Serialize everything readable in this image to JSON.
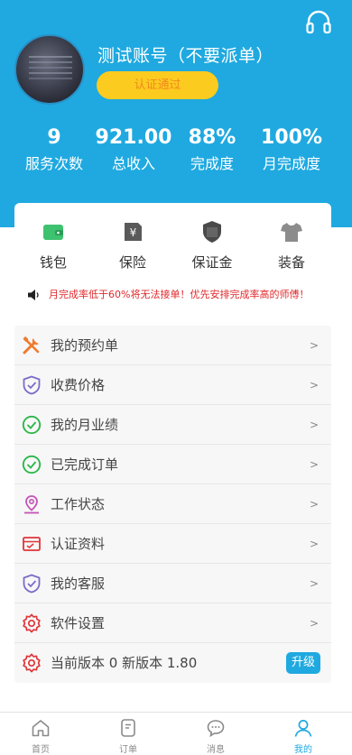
{
  "header": {
    "username": "测试账号（不要派单）",
    "verify_label": "认证通过"
  },
  "stats": [
    {
      "value": "9",
      "label": "服务次数"
    },
    {
      "value": "921.00",
      "label": "总收入"
    },
    {
      "value": "88%",
      "label": "完成度"
    },
    {
      "value": "100%",
      "label": "月完成度"
    }
  ],
  "quick_actions": [
    {
      "label": "钱包",
      "icon": "wallet-icon"
    },
    {
      "label": "保险",
      "icon": "insurance-icon"
    },
    {
      "label": "保证金",
      "icon": "deposit-icon"
    },
    {
      "label": "装备",
      "icon": "tshirt-icon"
    }
  ],
  "notice": {
    "text": "月完成率低于60%将无法接单！优先安排完成率高的师傅！"
  },
  "menu": [
    {
      "label": "我的预约单",
      "icon": "tools-icon",
      "chevron": ">"
    },
    {
      "label": "收费价格",
      "icon": "shield-check-icon",
      "chevron": ">"
    },
    {
      "label": "我的月业绩",
      "icon": "check-circle-icon",
      "chevron": ">"
    },
    {
      "label": "已完成订单",
      "icon": "check-circle-icon",
      "chevron": ">"
    },
    {
      "label": "工作状态",
      "icon": "location-pin-icon",
      "chevron": ">"
    },
    {
      "label": "认证资料",
      "icon": "id-card-icon",
      "chevron": ">"
    },
    {
      "label": "我的客服",
      "icon": "shield-check-icon",
      "chevron": ">"
    },
    {
      "label": "软件设置",
      "icon": "gear-icon",
      "chevron": ">"
    },
    {
      "label": "当前版本 0 新版本 1.80",
      "icon": "gear-icon",
      "button": "升级"
    }
  ],
  "tabs": [
    {
      "label": "首页",
      "icon": "home-icon",
      "active": false
    },
    {
      "label": "订单",
      "icon": "order-icon",
      "active": false
    },
    {
      "label": "消息",
      "icon": "message-icon",
      "active": false
    },
    {
      "label": "我的",
      "icon": "user-icon",
      "active": true
    }
  ],
  "colors": {
    "brand_blue": "#1fa9e0",
    "verify_yellow": "#fccb1f",
    "verify_text": "#f08a1d",
    "notice_red": "#e0292c",
    "wallet_green": "#3ec270",
    "check_green": "#2cb84b",
    "shield_purple": "#7a6cc9",
    "gear_red": "#e0353a",
    "tools_orange": "#f07a2d",
    "pin_magenta": "#c454b8"
  }
}
